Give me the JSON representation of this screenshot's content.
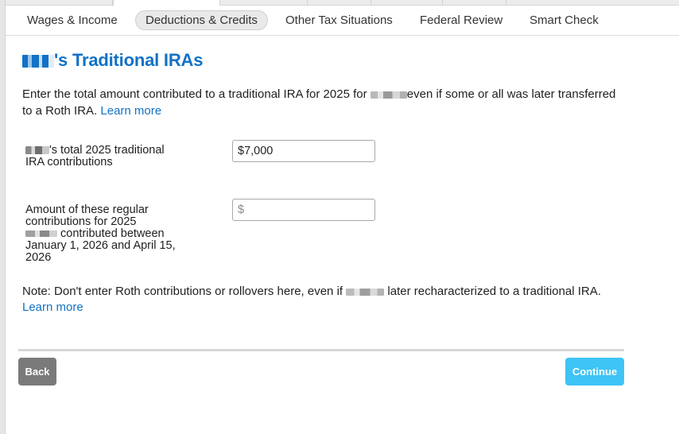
{
  "colors": {
    "accent": "#1172c6",
    "continue_button": "#3ec4f5",
    "back_button": "#7a7a7a",
    "active_tab_bg": "#e9e9e9"
  },
  "tabs": [
    {
      "label": "Wages & Income",
      "active": false
    },
    {
      "label": "Deductions & Credits",
      "active": true
    },
    {
      "label": "Other Tax Situations",
      "active": false
    },
    {
      "label": "Federal Review",
      "active": false
    },
    {
      "label": "Smart Check",
      "active": false
    }
  ],
  "page": {
    "title_suffix": "'s Traditional IRAs",
    "intro_before": "Enter the total amount contributed to a traditional IRA for 2025 for ",
    "intro_after": "even if some or all was later transferred to a Roth IRA.",
    "intro_link": "Learn more"
  },
  "fields": {
    "total": {
      "label_suffix": "'s total 2025 traditional IRA contributions",
      "value": "$7,000"
    },
    "late": {
      "label_before": "Amount of these regular contributions for 2025",
      "label_after": " contributed between January 1, 2026 and April 15, 2026",
      "placeholder": "$"
    }
  },
  "note": {
    "before": "Note: Don't enter Roth contributions or rollovers here, even if ",
    "after": " later recharacterized to a traditional IRA.",
    "link": "Learn more"
  },
  "buttons": {
    "back": "Back",
    "continue": "Continue"
  }
}
